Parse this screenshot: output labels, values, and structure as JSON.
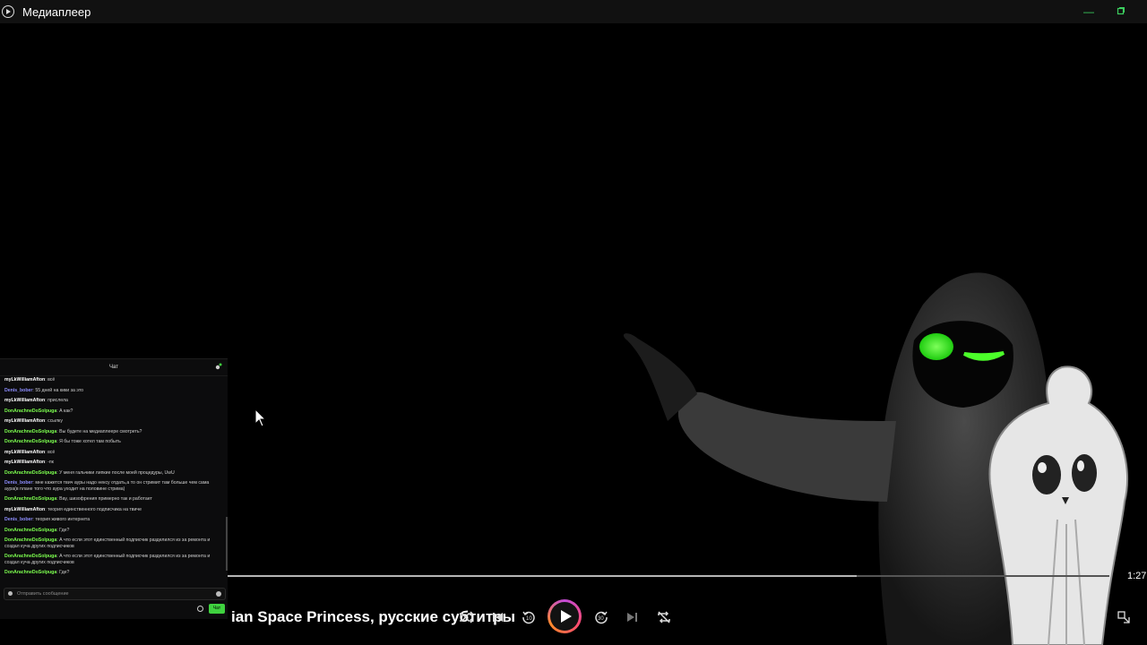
{
  "app": {
    "title": "Медиаплеер"
  },
  "chat": {
    "title": "Чат",
    "messages": [
      {
        "user": "myLkWilliamAfton",
        "cls": "mylk",
        "text": "всё"
      },
      {
        "user": "Denis_bober",
        "cls": "denis",
        "text": "55 дней на кики за это"
      },
      {
        "user": "myLkWilliamAfton",
        "cls": "mylk",
        "text": "прислела"
      },
      {
        "user": "DonArachneDoSolpuga",
        "cls": "don",
        "text": "А как?"
      },
      {
        "user": "myLkWilliamAfton",
        "cls": "mylk",
        "text": "ссылку"
      },
      {
        "user": "DonArachneDoSolpuga",
        "cls": "don",
        "text": "Вы будете на медиаплеере смотреть?"
      },
      {
        "user": "DonArachneDoSolpuga",
        "cls": "don",
        "text": "Я бы тоже хотел там побыть"
      },
      {
        "user": "myLkWilliamAfton",
        "cls": "mylk",
        "text": "всё"
      },
      {
        "user": "myLkWilliamAfton",
        "cls": "mylk",
        "text": "-пк"
      },
      {
        "user": "DonArachneDoSolpuga",
        "cls": "don",
        "text": "У меня гальчики липкие после моей процедуры, UwU"
      },
      {
        "user": "Denis_bober",
        "cls": "denis",
        "text": "мне кажется твич ауры надо нексу отдать,а то он стримит там больше чем сама аура(в плане того что аура уходит на половине стрима)"
      },
      {
        "user": "DonArachneDoSolpuga",
        "cls": "don",
        "text": "Вау, шизофрения примерно так и работает"
      },
      {
        "user": "myLkWilliamAfton",
        "cls": "mylk",
        "text": "теория единственного подписчика на твиче"
      },
      {
        "user": "Denis_bober",
        "cls": "denis",
        "text": "теория живого интернета"
      },
      {
        "user": "DonArachneDoSolpuga",
        "cls": "don",
        "text": "Где?"
      },
      {
        "user": "DonArachneDoSolpuga",
        "cls": "don",
        "text": "А что если этот единственный подписчик разделился из за ремонта и создал куча других подписчиков"
      },
      {
        "user": "DonArachneDoSolpuga",
        "cls": "don",
        "text": "А что если этот единственный подписчик разделился из за ремонта и создал куча других подписчиков"
      },
      {
        "user": "DonArachneDoSolpuga",
        "cls": "don",
        "text": "Где?"
      }
    ],
    "input_placeholder": "Отправить сообщение",
    "send_label": "Чат"
  },
  "player": {
    "title_visible": "ian Space Princess, русские субтитры",
    "time": "1:27",
    "progress": 0.713,
    "accent_gradient": [
      "#c34bd8",
      "#ff4c70",
      "#ff8a2a"
    ]
  },
  "icons": {
    "shuffle": "shuffle-icon",
    "previous": "skip-previous-icon",
    "rewind": "rewind-10-icon",
    "play": "play-icon",
    "forward": "forward-30-icon",
    "next": "skip-next-icon",
    "repeat": "repeat-off-icon",
    "miniplayer": "mini-player-icon"
  },
  "colors": {
    "accent_green": "#3ccf5f",
    "chat_green": "#7dff4f",
    "chat_blue": "#8e8eff"
  }
}
